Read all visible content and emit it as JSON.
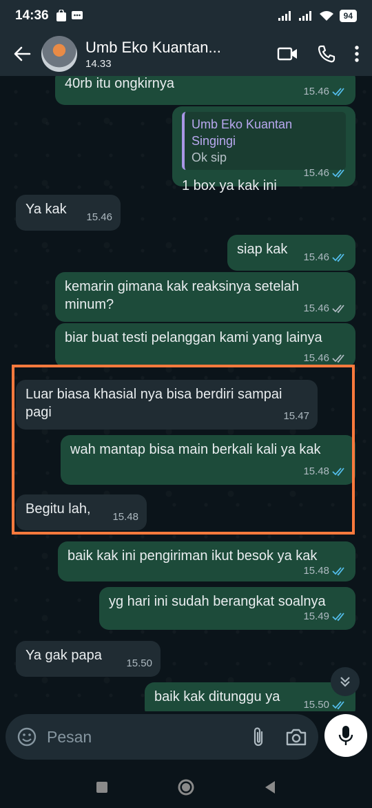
{
  "status": {
    "time": "14:36",
    "battery": "94"
  },
  "header": {
    "contact_name": "Umb Eko Kuantan...",
    "last_seen": "14.33"
  },
  "messages": [
    {
      "dir": "out",
      "text": "40rb itu ongkirnya",
      "time": "15.46"
    },
    {
      "dir": "out",
      "quote_name": "Umb Eko Kuantan Singingi",
      "quote_text": "Ok sip",
      "text": "1 box ya kak ini",
      "time": "15.46"
    },
    {
      "dir": "in",
      "text": "Ya kak",
      "time": "15.46"
    },
    {
      "dir": "out",
      "text": "siap kak",
      "time": "15.46"
    },
    {
      "dir": "out",
      "text": "kemarin gimana kak reaksinya setelah minum?",
      "time": "15.46"
    },
    {
      "dir": "out",
      "text": "biar buat testi pelanggan kami yang lainya",
      "time": "15.46"
    },
    {
      "dir": "in",
      "text": "Luar biasa khasial nya bisa berdiri sampai pagi",
      "time": "15.47"
    },
    {
      "dir": "out",
      "text": "wah mantap bisa main berkali kali ya kak",
      "time": "15.48"
    },
    {
      "dir": "in",
      "text": "Begitu lah,",
      "time": "15.48"
    },
    {
      "dir": "out",
      "text": "baik kak ini pengiriman ikut  besok ya kak",
      "time": "15.48"
    },
    {
      "dir": "out",
      "text": "yg hari ini sudah berangkat soalnya",
      "time": "15.49"
    },
    {
      "dir": "in",
      "text": "Ya gak papa",
      "time": "15.50"
    },
    {
      "dir": "out",
      "text": "baik kak ditunggu ya",
      "time": "15.50"
    }
  ],
  "composer": {
    "placeholder": "Pesan"
  },
  "colors": {
    "highlight": "#ff7a3d",
    "read_tick": "#53bdeb",
    "delivered_tick": "#aebac1"
  }
}
